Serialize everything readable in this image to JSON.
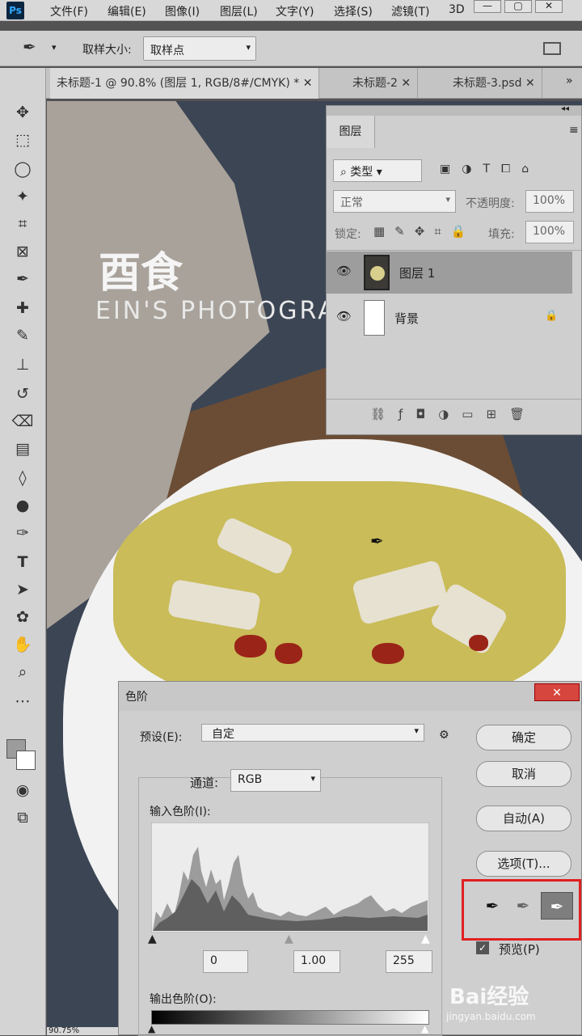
{
  "app": {
    "logo": "Ps"
  },
  "menu": [
    "文件(F)",
    "编辑(E)",
    "图像(I)",
    "图层(L)",
    "文字(Y)",
    "选择(S)",
    "滤镜(T)",
    "3D"
  ],
  "options": {
    "sample_label": "取样大小:",
    "sample_value": "取样点"
  },
  "tabs": [
    "未标题-1 @ 90.8% (图层 1, RGB/8#/CMYK) *",
    "未标题-2",
    "未标题-3.psd"
  ],
  "canvas": {
    "watermark_title": "酉食",
    "watermark_sub": "EIN'S PHOTOGRA"
  },
  "layers": {
    "title": "图层",
    "filter_kind": "类型",
    "blend_mode": "正常",
    "opacity_label": "不透明度:",
    "opacity": "100%",
    "lock_label": "锁定:",
    "fill_label": "填充:",
    "fill": "100%",
    "items": [
      {
        "name": "图层 1"
      },
      {
        "name": "背景"
      }
    ]
  },
  "levels": {
    "title": "色阶",
    "preset_label": "预设(E):",
    "preset_value": "自定",
    "channel_label": "通道:",
    "channel_value": "RGB",
    "input_label": "输入色阶(I):",
    "input_black": "0",
    "input_gamma": "1.00",
    "input_white": "255",
    "output_label": "输出色阶(O):",
    "buttons": [
      "确定",
      "取消",
      "自动(A)",
      "选项(T)..."
    ],
    "preview_label": "预览(P)"
  },
  "colors": {
    "highlight": "#e02020"
  },
  "status": {
    "zoom": "90.75%"
  },
  "watermark": {
    "site": "jingyan.baidu.com",
    "brand": "Bai经验"
  }
}
